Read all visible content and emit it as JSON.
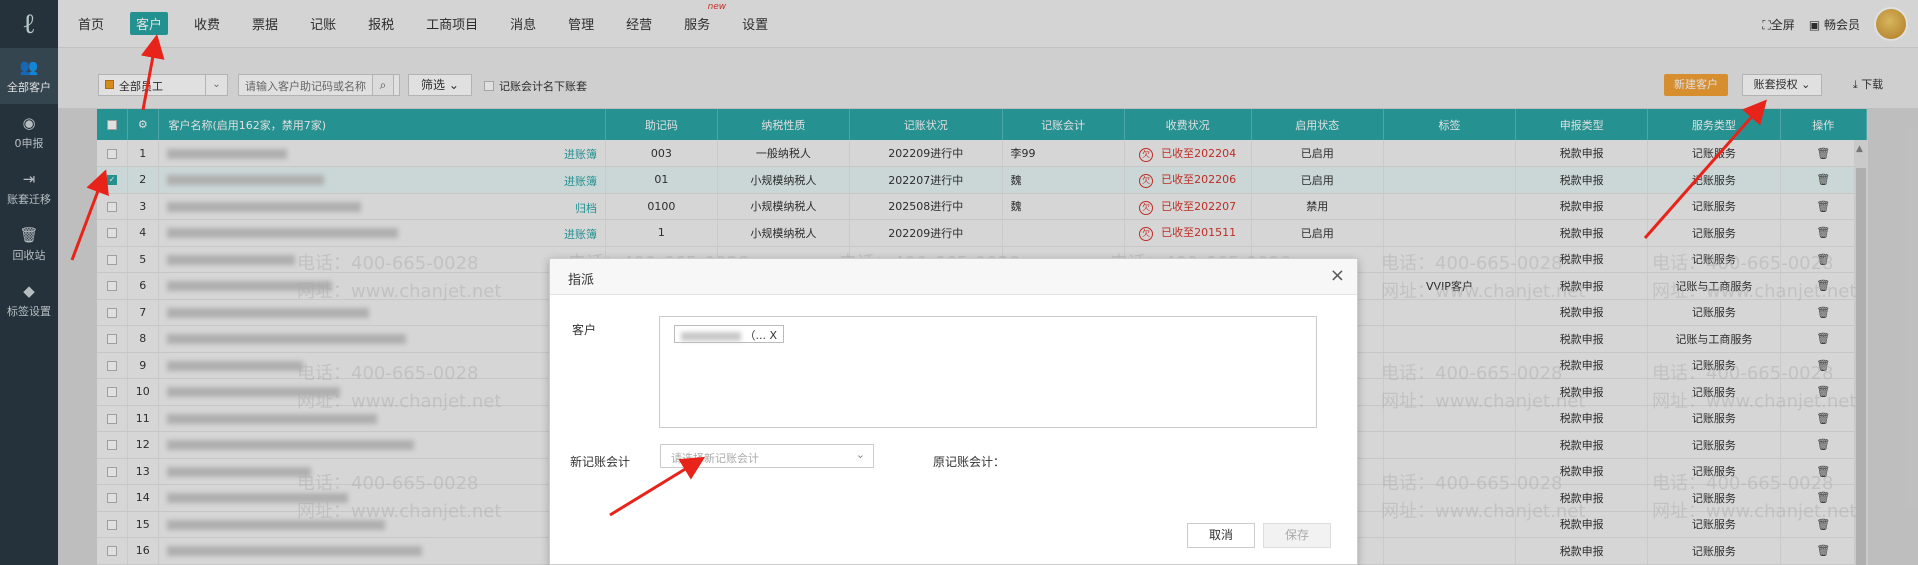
{
  "sidebar": {
    "items": [
      {
        "label": "全部客户",
        "icon": "users-icon"
      },
      {
        "label": "0申报",
        "icon": "zero-report-icon"
      },
      {
        "label": "账套迁移",
        "icon": "migrate-icon"
      },
      {
        "label": "回收站",
        "icon": "trash-icon"
      },
      {
        "label": "标签设置",
        "icon": "tag-icon"
      }
    ]
  },
  "topnav": {
    "items": [
      "首页",
      "客户",
      "收费",
      "票据",
      "记账",
      "报税",
      "工商项目",
      "消息",
      "管理",
      "经营",
      "服务",
      "设置"
    ],
    "new_badge": "new",
    "fullscreen": "全屏",
    "member": "畅会员"
  },
  "toolbar": {
    "employee_select": "全部员工",
    "search_placeholder": "请输入客户助记码或名称",
    "filter": "筛选",
    "checkbox_label": "记账会计名下账套",
    "new_customer": "新建客户",
    "auth": "账套授权",
    "download": "下载"
  },
  "table": {
    "headers": [
      "客户名称(启用162家，禁用7家)",
      "助记码",
      "纳税性质",
      "记账状况",
      "记账会计",
      "收费状况",
      "启用状态",
      "标签",
      "申报类型",
      "服务类型",
      "操作"
    ],
    "rows": [
      {
        "no": "1",
        "action": "进账簿",
        "code": "003",
        "nature": "一般纳税人",
        "status": "202209进行中",
        "accountant": "李99",
        "fee": "已收至202204",
        "enabled": "已启用",
        "tag": "",
        "report": "税款申报",
        "service": "记账服务"
      },
      {
        "no": "2",
        "action": "进账簿",
        "code": "01",
        "nature": "小规模纳税人",
        "status": "202207进行中",
        "accountant": "魏",
        "fee": "已收至202206",
        "enabled": "已启用",
        "tag": "",
        "report": "税款申报",
        "service": "记账服务"
      },
      {
        "no": "3",
        "action": "归档",
        "code": "0100",
        "nature": "小规模纳税人",
        "status": "202508进行中",
        "accountant": "魏",
        "fee": "已收至202207",
        "enabled": "禁用",
        "tag": "",
        "report": "税款申报",
        "service": "记账服务"
      },
      {
        "no": "4",
        "action": "进账簿",
        "code": "1",
        "nature": "小规模纳税人",
        "status": "202209进行中",
        "accountant": "",
        "fee": "已收至201511",
        "enabled": "已启用",
        "tag": "",
        "report": "税款申报",
        "service": "记账服务"
      },
      {
        "no": "5",
        "report": "税款申报",
        "service": "记账服务",
        "tag": ""
      },
      {
        "no": "6",
        "report": "税款申报",
        "service": "记账与工商服务",
        "tag": "VVIP客户"
      },
      {
        "no": "7",
        "report": "税款申报",
        "service": "记账服务",
        "tag": ""
      },
      {
        "no": "8",
        "report": "税款申报",
        "service": "记账与工商服务",
        "tag": ""
      },
      {
        "no": "9",
        "report": "税款申报",
        "service": "记账服务",
        "tag": ""
      },
      {
        "no": "10",
        "report": "税款申报",
        "service": "记账服务",
        "tag": ""
      },
      {
        "no": "11",
        "report": "税款申报",
        "service": "记账服务",
        "tag": ""
      },
      {
        "no": "12",
        "report": "税款申报",
        "service": "记账服务",
        "tag": ""
      },
      {
        "no": "13",
        "report": "税款申报",
        "service": "记账服务",
        "tag": ""
      },
      {
        "no": "14",
        "report": "税款申报",
        "service": "记账服务",
        "tag": ""
      },
      {
        "no": "15",
        "report": "税款申报",
        "service": "记账服务",
        "tag": ""
      },
      {
        "no": "16",
        "report": "税款申报",
        "service": "记账服务",
        "tag": ""
      }
    ]
  },
  "modal": {
    "title": "指派",
    "customer_label": "客户",
    "customer_tag": "（... X",
    "new_accountant_label": "新记账会计",
    "new_accountant_placeholder": "请选择新记账会计",
    "old_accountant_label": "原记账会计：",
    "cancel": "取消",
    "save": "保存"
  },
  "watermark": {
    "phone": "电话：400-665-0028",
    "site": "网址：www.chanjet.net"
  },
  "colors": {
    "accent": "#2ca5a6",
    "orange": "#f4a236",
    "red": "#d9342b",
    "arrow": "#e8231a"
  }
}
